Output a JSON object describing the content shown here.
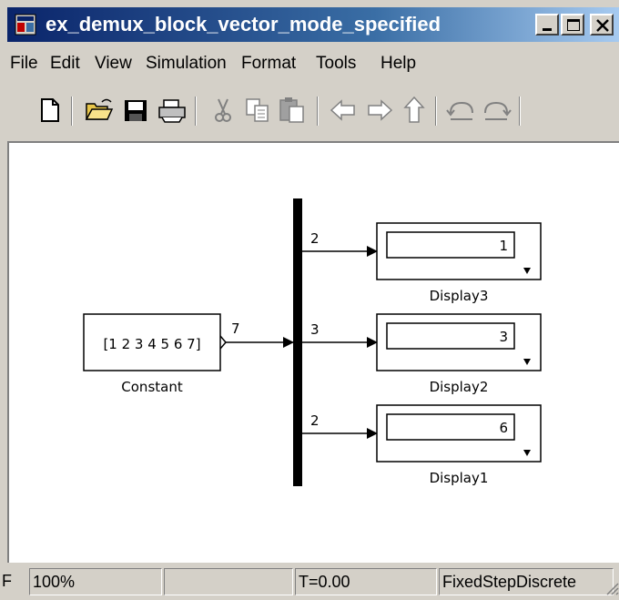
{
  "window": {
    "title": "ex_demux_block_vector_mode_specified"
  },
  "menu": {
    "items": [
      "File",
      "Edit",
      "View",
      "Simulation",
      "Format",
      "Tools",
      "Help"
    ]
  },
  "toolbar": {
    "icons": [
      "new-icon",
      "open-icon",
      "save-icon",
      "print-icon",
      "cut-icon",
      "copy-icon",
      "paste-icon",
      "back-icon",
      "forward-icon",
      "up-icon",
      "undo-icon",
      "redo-icon"
    ]
  },
  "diagram": {
    "constant": {
      "value": "[1 2 3 4 5 6 7]",
      "name": "Constant"
    },
    "input_width": "7",
    "outputs": [
      {
        "width": "2",
        "value": "1",
        "name": "Display3"
      },
      {
        "width": "3",
        "value": "3",
        "name": "Display2"
      },
      {
        "width": "2",
        "value": "6",
        "name": "Display1"
      }
    ]
  },
  "status": {
    "left": "F",
    "zoom": "100%",
    "blank": "",
    "time": "T=0.00",
    "solver": "FixedStepDiscrete"
  },
  "colors": {
    "title_bar": "#0a246a",
    "canvas": "#ffffff",
    "chrome": "#d4d0c8"
  }
}
